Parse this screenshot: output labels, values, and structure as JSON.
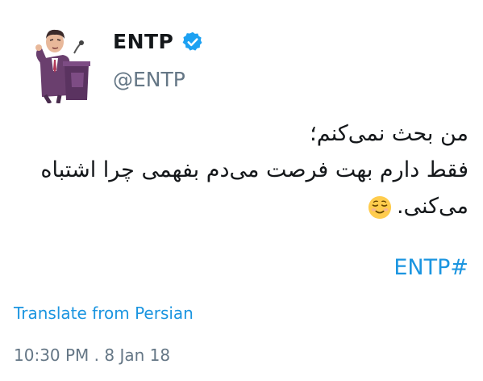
{
  "user": {
    "display_name": "ENTP",
    "handle": "@ENTP",
    "verified": true,
    "avatar_icon": "man-at-podium-avatar"
  },
  "tweet": {
    "lines": [
      "من بحث نمی‌کنم؛",
      "فقط دارم بهت فرصت می‌دم بفهمی چرا اشتباه",
      "می‌کنی."
    ],
    "emoji": "relieved-face-emoji",
    "hashtag": "ENTP#"
  },
  "translate_label": "Translate from Persian",
  "timestamp": "10:30 PM . 8 Jan 18",
  "colors": {
    "link": "#1b95e0",
    "muted": "#657786",
    "text": "#14171a",
    "verified": "#1da1f2"
  }
}
